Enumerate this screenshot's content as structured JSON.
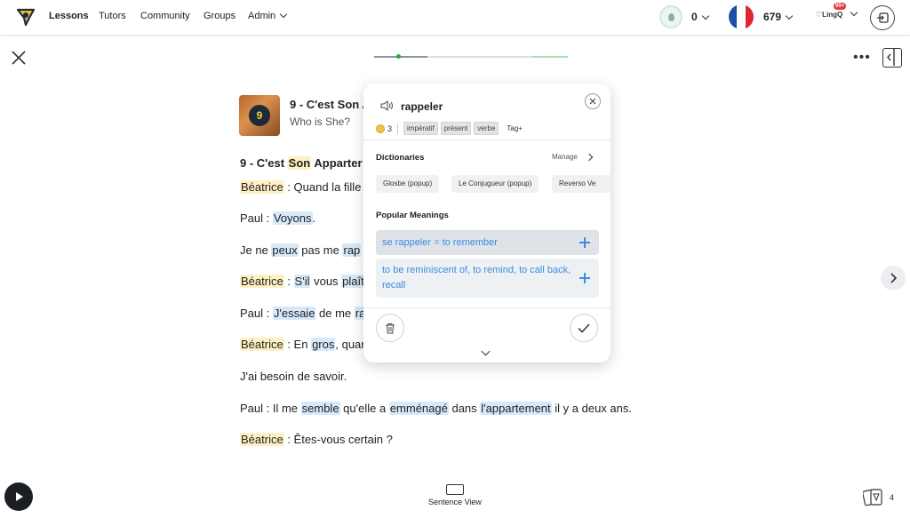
{
  "nav": {
    "items": [
      {
        "label": "Lessons",
        "active": true
      },
      {
        "label": "Tutors"
      },
      {
        "label": "Community"
      },
      {
        "label": "Groups"
      },
      {
        "label": "Admin"
      }
    ],
    "streak_count": "0",
    "known_words": "679",
    "lingq_logo": "LingQ",
    "notification_badge": "99+",
    "language": "French"
  },
  "lesson": {
    "title": "9 - C'est Son Appartement",
    "title_visible": "9 - C'est Son A",
    "subtitle": "Who is She?",
    "thumb_number": "9",
    "progress_pct": 12
  },
  "text_lines": [
    {
      "words": [
        {
          "t": "9 - C'est "
        },
        {
          "t": "Son",
          "s": "yellow"
        },
        {
          "t": " Apparter"
        }
      ],
      "bold": true
    },
    {
      "words": [
        {
          "t": "Béatrice",
          "s": "yellow"
        },
        {
          "t": " : Quand la fille"
        }
      ]
    },
    {
      "words": [
        {
          "t": "Paul : "
        },
        {
          "t": "Voyons",
          "s": "blue"
        },
        {
          "t": "."
        }
      ]
    },
    {
      "words": [
        {
          "t": "Je ne "
        },
        {
          "t": "peux",
          "s": "blue"
        },
        {
          "t": " pas me "
        },
        {
          "t": "rap",
          "s": "blue"
        }
      ]
    },
    {
      "words": [
        {
          "t": "Béatrice",
          "s": "yellow"
        },
        {
          "t": " : "
        },
        {
          "t": "S'il",
          "s": "blue"
        },
        {
          "t": " vous "
        },
        {
          "t": "plaît",
          "s": "blue"
        }
      ]
    },
    {
      "words": [
        {
          "t": "Paul : "
        },
        {
          "t": "J'essaie",
          "s": "blue"
        },
        {
          "t": " de me "
        },
        {
          "t": "ra",
          "s": "blue"
        }
      ]
    },
    {
      "words": [
        {
          "t": "Béatrice",
          "s": "yellow"
        },
        {
          "t": " : En "
        },
        {
          "t": "gros",
          "s": "blue"
        },
        {
          "t": ", quan"
        }
      ]
    },
    {
      "words": [
        {
          "t": "J'ai besoin de savoir."
        }
      ]
    },
    {
      "words": [
        {
          "t": "Paul : Il me "
        },
        {
          "t": "semble",
          "s": "blue"
        },
        {
          "t": " qu'elle a "
        },
        {
          "t": "emménagé",
          "s": "blue"
        },
        {
          "t": " dans "
        },
        {
          "t": "l'appartement",
          "s": "blue"
        },
        {
          "t": " il y a deux ans."
        }
      ]
    },
    {
      "words": [
        {
          "t": "Béatrice",
          "s": "yellow"
        },
        {
          "t": " : Êtes-vous certain ?"
        }
      ]
    }
  ],
  "popup": {
    "term": "rappeler",
    "status_level": "3",
    "tags": [
      "impératif",
      "présent",
      "verbe"
    ],
    "tag_add_label": "Tag+",
    "dictionaries_heading": "Dictionaries",
    "manage_label": "Manage",
    "dictionaries": [
      "Glosbe (popup)",
      "Le Conjugueur (popup)",
      "Reverso Ve"
    ],
    "popular_heading": "Popular Meanings",
    "meanings": [
      {
        "text": "se rappeler = to remember"
      },
      {
        "text": "to be reminiscent of, to remind, to call back, recall"
      }
    ]
  },
  "bottom": {
    "sentence_view_label": "Sentence View",
    "cards_count": "4"
  },
  "colors": {
    "known_highlight": "#fdf0c2",
    "new_highlight": "#d6e9fb",
    "meaning_text": "#3a8de0"
  }
}
